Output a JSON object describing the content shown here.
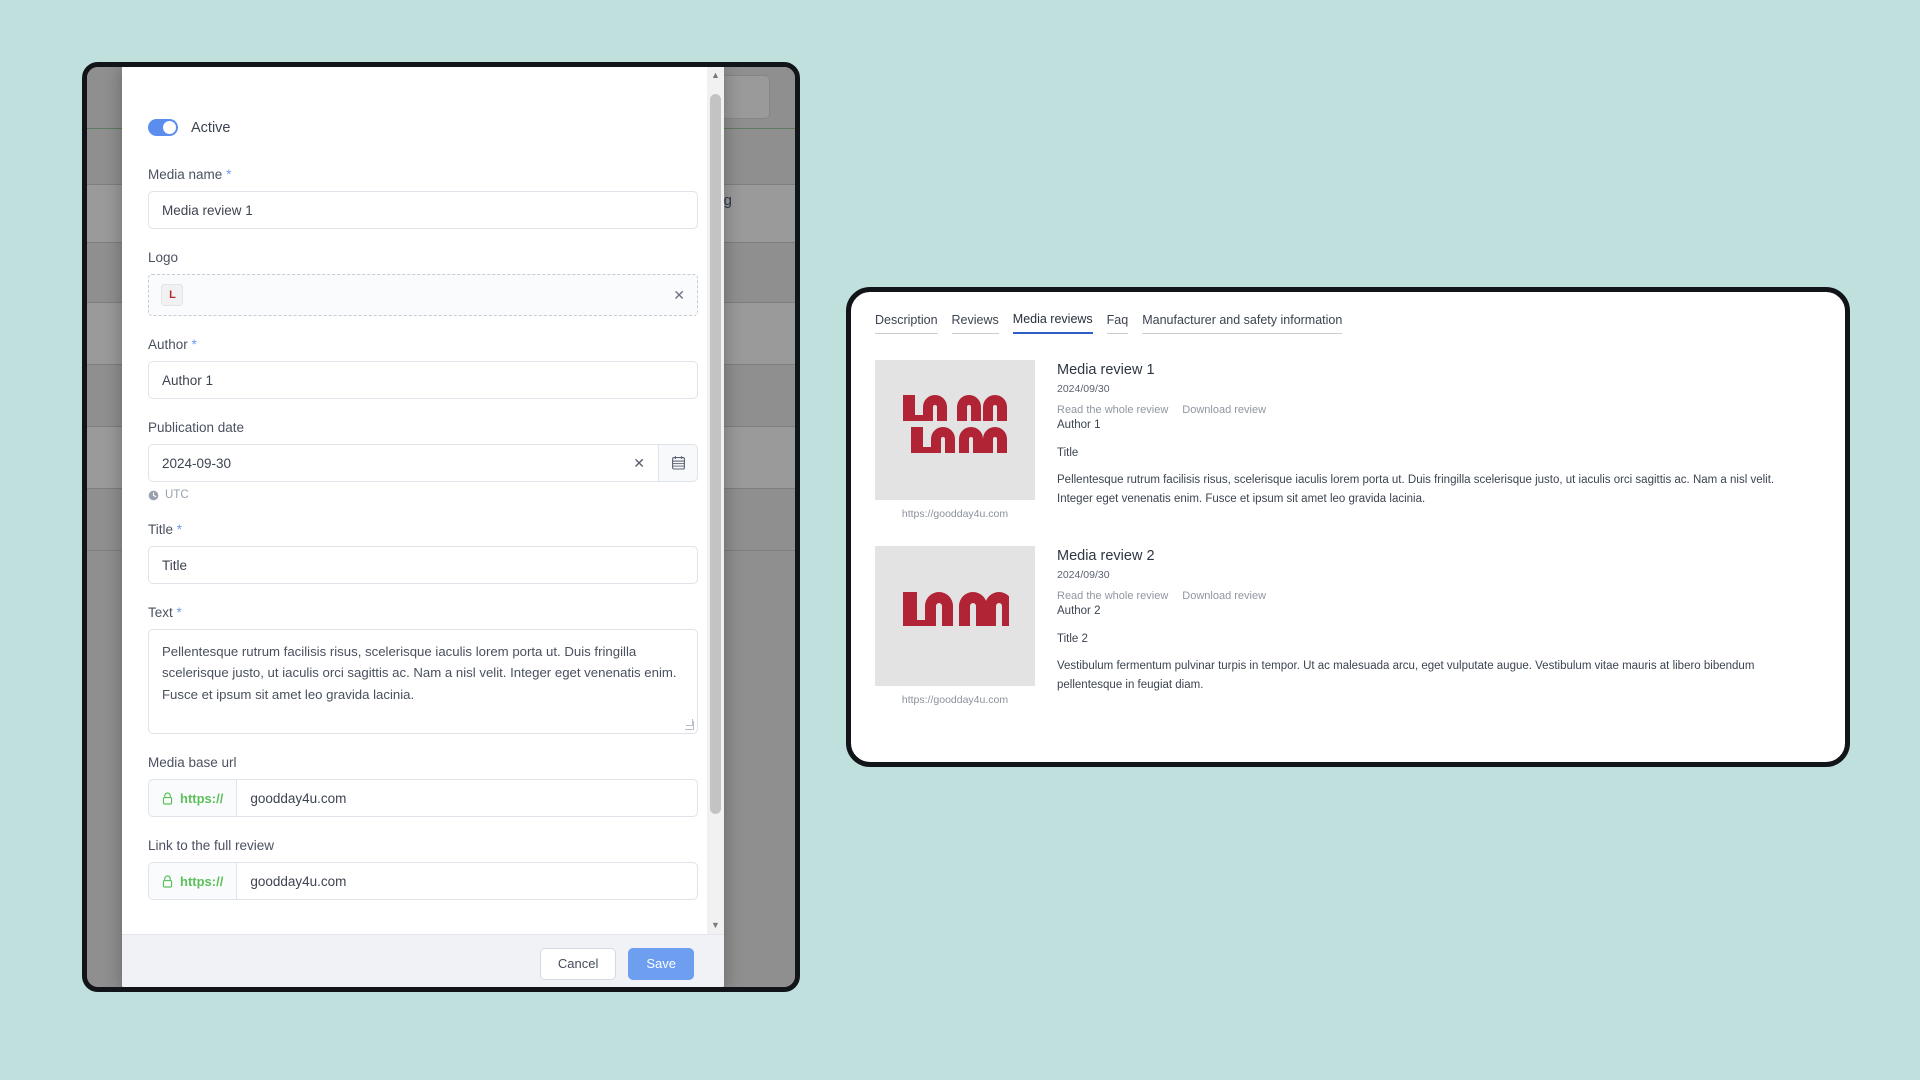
{
  "admin": {
    "background": {
      "selling_label": "Selling",
      "chevron_glyph": "⌄"
    },
    "form": {
      "active_toggle_label": "Active",
      "media_name": {
        "label": "Media name",
        "required": "*",
        "value": "Media review 1"
      },
      "logo": {
        "label": "Logo",
        "thumb_glyph": "L",
        "remove_glyph": "✕"
      },
      "author": {
        "label": "Author",
        "required": "*",
        "value": "Author 1"
      },
      "publication_date": {
        "label": "Publication date",
        "value": "2024-09-30",
        "clear_glyph": "✕",
        "timezone_hint": "UTC"
      },
      "title": {
        "label": "Title",
        "required": "*",
        "value": "Title"
      },
      "text": {
        "label": "Text",
        "required": "*",
        "value": "Pellentesque rutrum facilisis risus, scelerisque iaculis lorem porta ut. Duis fringilla scelerisque justo, ut iaculis orci sagittis ac. Nam a nisl velit. Integer eget venenatis enim. Fusce et ipsum sit amet leo gravida lacinia."
      },
      "media_base_url": {
        "label": "Media base url",
        "prefix": "https://",
        "value": "goodday4u.com"
      },
      "link_full_review": {
        "label": "Link to the full review",
        "prefix": "https://",
        "value": "goodday4u.com"
      }
    },
    "scrollbar": {
      "up_glyph": "▲",
      "down_glyph": "▼"
    },
    "footer": {
      "cancel_label": "Cancel",
      "save_label": "Save"
    }
  },
  "preview": {
    "tabs": [
      {
        "label": "Description",
        "active": false
      },
      {
        "label": "Reviews",
        "active": false
      },
      {
        "label": "Media reviews",
        "active": true
      },
      {
        "label": "Faq",
        "active": false
      },
      {
        "label": "Manufacturer and safety information",
        "active": false
      }
    ],
    "reviews": [
      {
        "logo_text": "LOGO",
        "logo_variant": "offset",
        "logo_url": "https://goodday4u.com",
        "name": "Media review 1",
        "date": "2024/09/30",
        "read_link": "Read the whole review",
        "download_link": "Download review",
        "author": "Author 1",
        "title": "Title",
        "text": "Pellentesque rutrum facilisis risus, scelerisque iaculis lorem porta ut. Duis fringilla scelerisque justo, ut iaculis orci sagittis ac. Nam a nisl velit. Integer eget venenatis enim. Fusce et ipsum sit amet leo gravida lacinia."
      },
      {
        "logo_text": "LOGO",
        "logo_variant": "solid",
        "logo_url": "https://goodday4u.com",
        "name": "Media review 2",
        "date": "2024/09/30",
        "read_link": "Read the whole review",
        "download_link": "Download review",
        "author": "Author 2",
        "title": "Title 2",
        "text": "Vestibulum fermentum pulvinar turpis in tempor. Ut ac malesuada arcu, eget vulputate augue. Vestibulum vitae mauris at libero bibendum pellentesque in feugiat diam."
      }
    ]
  },
  "colors": {
    "accent_blue": "#6d9ef0",
    "logo_red": "#b02435",
    "url_green": "#5cc15c",
    "tab_active": "#2f5fc4",
    "page_background": "#bfe0dd"
  }
}
